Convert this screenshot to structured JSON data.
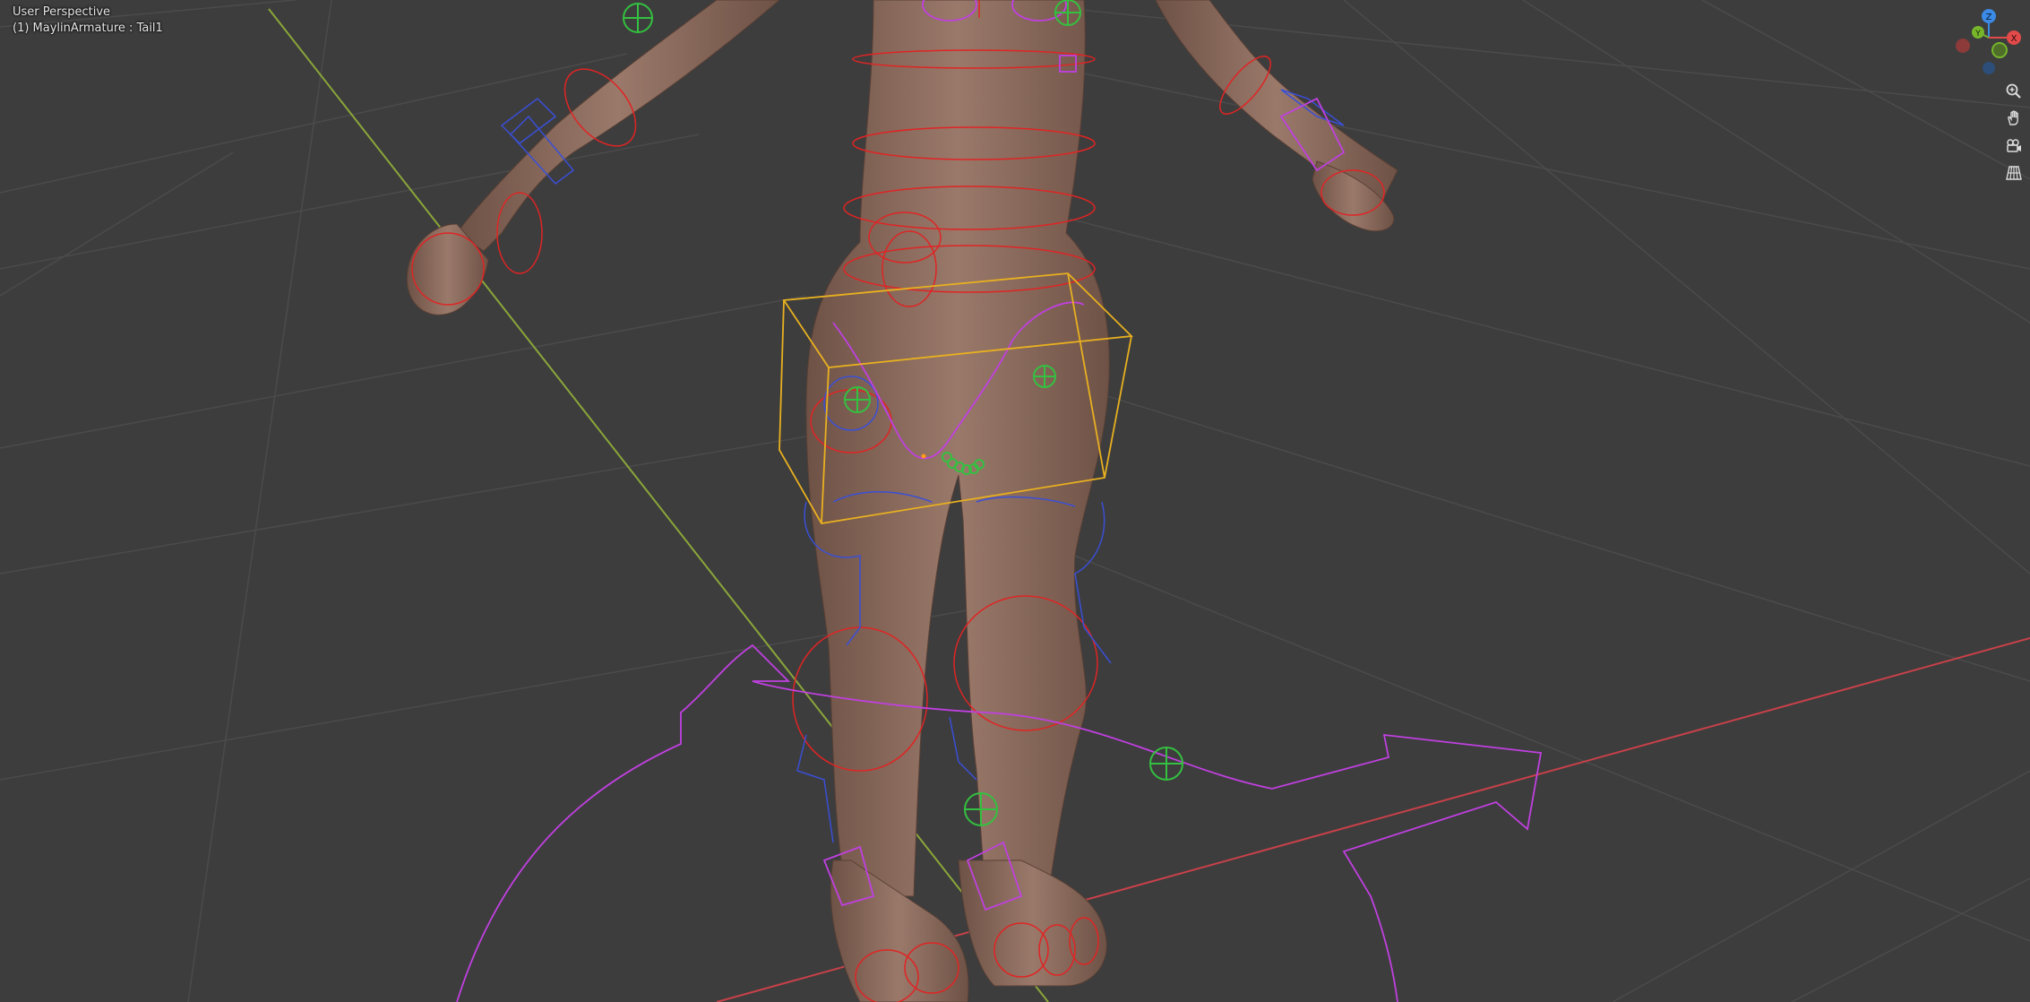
{
  "viewport": {
    "view_name": "User Perspective",
    "active_object": "(1) MaylinArmature : Tail1"
  },
  "gizmo": {
    "z_label": "Z",
    "y_label": "Y",
    "x_label": "X",
    "colors": {
      "x": "#e24a4a",
      "y": "#77b52b",
      "z": "#3b8ae6"
    }
  },
  "nav_buttons": [
    {
      "name": "zoom",
      "icon": "magnifier-plus-icon"
    },
    {
      "name": "pan",
      "icon": "hand-icon"
    },
    {
      "name": "camera",
      "icon": "camera-icon"
    },
    {
      "name": "perspective",
      "icon": "grid-icon"
    }
  ],
  "colors": {
    "background": "#3d3d3d",
    "grid": "#4a4a4a",
    "axis_x": "#c8414a",
    "axis_y": "#8aa63a",
    "bone_red": "#e02424",
    "bone_blue": "#3a4fd6",
    "bone_magenta": "#c040e0",
    "bone_green": "#34c040",
    "selection_box": "#e8b020",
    "skin": "#8a6a5c"
  }
}
